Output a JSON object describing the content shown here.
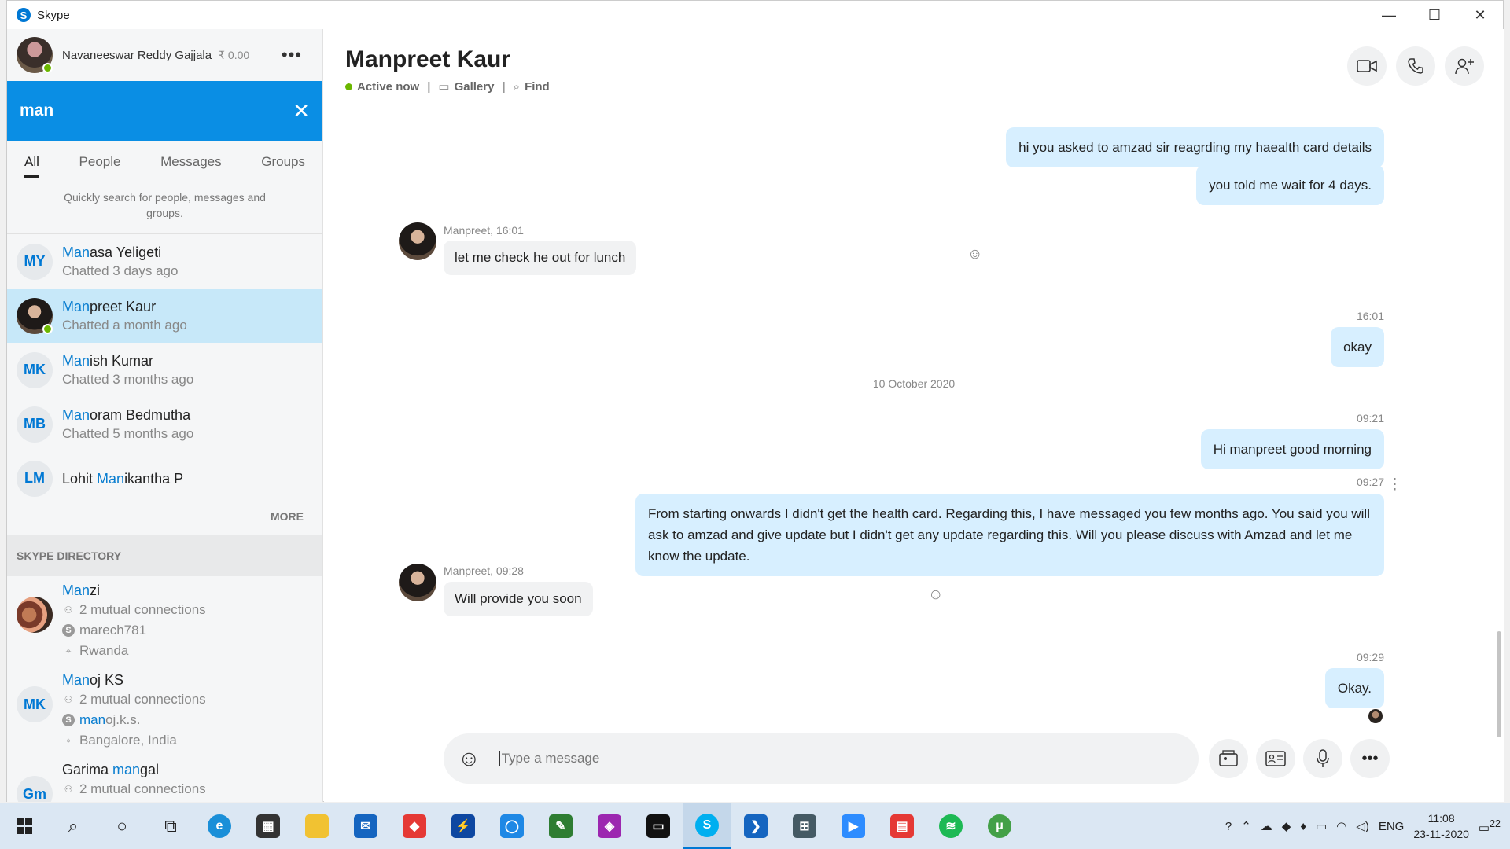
{
  "window": {
    "app_title": "Skype",
    "minimize": "—",
    "maximize": "☐",
    "close": "✕"
  },
  "profile": {
    "name": "Navaneeswar Reddy Gajjala",
    "credit": "₹ 0.00",
    "more": "•••"
  },
  "search": {
    "query": "man",
    "close": "✕"
  },
  "filter_tabs": [
    "All",
    "People",
    "Messages",
    "Groups"
  ],
  "search_hint": "Quickly search for people, messages and groups.",
  "results": [
    {
      "initials": "MY",
      "name_hl": "Man",
      "name_rest": "asa Yeligeti",
      "sub": "Chatted 3 days ago"
    },
    {
      "initials": "",
      "name_hl": "Man",
      "name_rest": "preet Kaur",
      "sub": "Chatted a month ago"
    },
    {
      "initials": "MK",
      "name_hl": "Man",
      "name_rest": "ish Kumar",
      "sub": "Chatted 3 months ago"
    },
    {
      "initials": "MB",
      "name_hl": "Man",
      "name_rest": "oram Bedmutha",
      "sub": "Chatted 5 months ago"
    },
    {
      "initials": "LM",
      "name_pre": "Lohit ",
      "name_hl": "Man",
      "name_rest": "ikantha P"
    }
  ],
  "more_label": "MORE",
  "directory": {
    "header": "SKYPE DIRECTORY",
    "items": [
      {
        "name_hl": "Man",
        "name_rest": "zi",
        "mutual": "2 mutual connections",
        "skype_id": "marech781",
        "location": "Rwanda"
      },
      {
        "initials": "MK",
        "name_hl": "Man",
        "name_rest": "oj KS",
        "mutual": "2 mutual connections",
        "skype_id_hl": "man",
        "skype_id_rest": "oj.k.s.",
        "location": "Bangalore, India"
      },
      {
        "initials": "Gm",
        "name_pre": "Garima ",
        "name_hl": "man",
        "name_rest": "gal",
        "mutual": "2 mutual connections"
      }
    ]
  },
  "chat": {
    "title": "Manpreet Kaur",
    "status": "Active now",
    "gallery": "Gallery",
    "find": "Find",
    "date_divider": "10 October 2020",
    "messages": [
      {
        "dir": "out",
        "text": "hi you asked to amzad sir reagrding my haealth card details"
      },
      {
        "dir": "out",
        "text": "you told me wait for 4 days."
      },
      {
        "dir": "in",
        "meta": "Manpreet, 16:01",
        "text": "let me check he out for lunch"
      },
      {
        "dir": "out",
        "time": "16:01",
        "text": "okay"
      },
      {
        "dir": "out",
        "time": "09:21",
        "text": "Hi manpreet good morning"
      },
      {
        "dir": "out",
        "time": "09:27",
        "text": "From starting onwards I didn't get the health card. Regarding this, I have messaged you few months ago. You said you will ask to amzad and give update but I didn't get any update regarding this. Will you please discuss with Amzad and let me know the update."
      },
      {
        "dir": "in",
        "meta": "Manpreet, 09:28",
        "text": "Will provide you soon"
      },
      {
        "dir": "out",
        "time": "09:29",
        "text": "Okay."
      }
    ],
    "composer_placeholder": "Type a message"
  },
  "taskbar": {
    "lang": "ENG",
    "time": "11:08",
    "date": "23-11-2020",
    "notifications": "22"
  },
  "colors": {
    "accent": "#0a8ee4",
    "selected": "#c7e8f9",
    "bubble_out": "#d7efff",
    "online": "#6bb700"
  }
}
